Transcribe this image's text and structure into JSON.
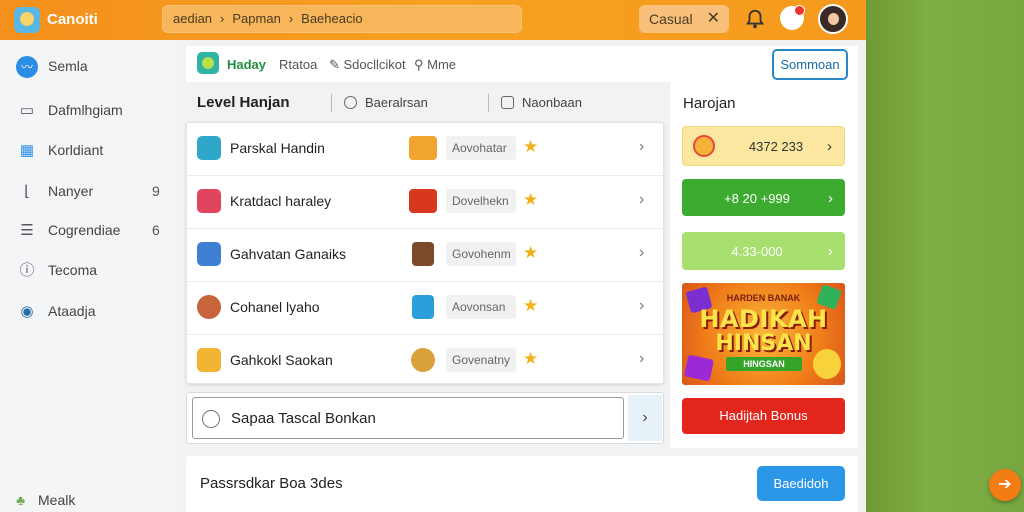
{
  "topbar": {
    "app_title": "Canoiti",
    "breadcrumb": [
      "aedian",
      "Papman",
      "Baeheacio"
    ],
    "filter_chip": "Casual",
    "icons": [
      "bell-icon",
      "notification-icon",
      "avatar"
    ]
  },
  "sidebar": {
    "items": [
      {
        "label": "Semla",
        "icon": "active-icon",
        "count": ""
      },
      {
        "label": "Dafmlhgiam",
        "icon": "folder-icon",
        "count": ""
      },
      {
        "label": "Korldiant",
        "icon": "calendar-icon",
        "count": ""
      },
      {
        "label": "Nanyer",
        "icon": "bracket-icon",
        "count": "9"
      },
      {
        "label": "Cogrendiae",
        "icon": "list-icon",
        "count": "6"
      },
      {
        "label": "Tecoma",
        "icon": "info-icon",
        "count": ""
      },
      {
        "label": "Ataadja",
        "icon": "dot-icon",
        "count": ""
      }
    ],
    "footer": "Mealk"
  },
  "toolbar": {
    "brand": "Haday",
    "links": [
      "Rtatoa",
      "Sdocllcikot",
      "Mme"
    ],
    "button": "Sommoan"
  },
  "level_panel": {
    "title": "Level Hanjan",
    "tabs": [
      "Baeralrsan",
      "Naonbaan"
    ],
    "rows": [
      {
        "name": "Parskal Handin",
        "tag": "Aovohatar"
      },
      {
        "name": "Kratdacl haraley",
        "tag": "Dovelhekn"
      },
      {
        "name": "Gahvatan Ganaiks",
        "tag": "Govohenm"
      },
      {
        "name": "Cohanel lyaho",
        "tag": "Aovonsan"
      },
      {
        "name": "Gahkokl Saokan",
        "tag": "Govenatny"
      }
    ]
  },
  "search": {
    "text": "Sapaa Tascal Bonkan"
  },
  "bottom_card": {
    "title": "Passrsdkar Boa 3des",
    "button": "Baedidoh"
  },
  "right_panel": {
    "title": "Harojan",
    "buttons": [
      "4372 233",
      "+8 20 +999",
      "4.33-000"
    ],
    "promo": {
      "line1": "HARDEN BANAK",
      "line2": "HADIKAH",
      "line3": "HINSAN",
      "line4": "HINGSAN"
    },
    "bonus_button": "Hadijtah Bonus"
  }
}
